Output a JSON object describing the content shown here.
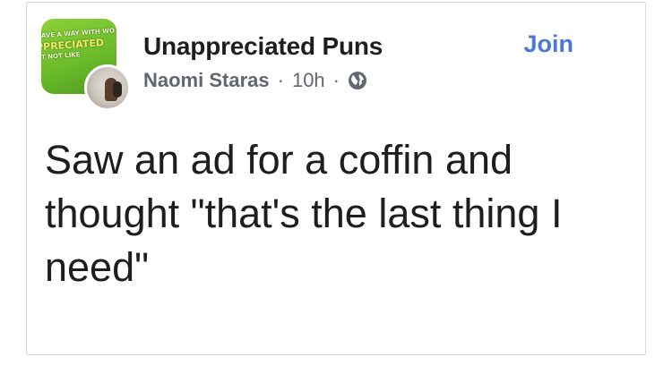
{
  "post": {
    "group_name": "Unappreciated Puns",
    "author": "Naomi Staras",
    "separator": "·",
    "time": "10h",
    "join_label": "Join",
    "visibility_icon": "globe-icon",
    "text": "Saw an ad for a coffin and thought \"that's the last thing I need\"",
    "group_avatar_text": [
      "HAVE A WAY WITH WO",
      "PPRECIATED",
      "OT NOT LIKE"
    ]
  },
  "colors": {
    "link": "#4b78d8",
    "primary_text": "#1c1e21",
    "secondary_text": "#606770",
    "group_avatar": "#6cbb2a"
  }
}
